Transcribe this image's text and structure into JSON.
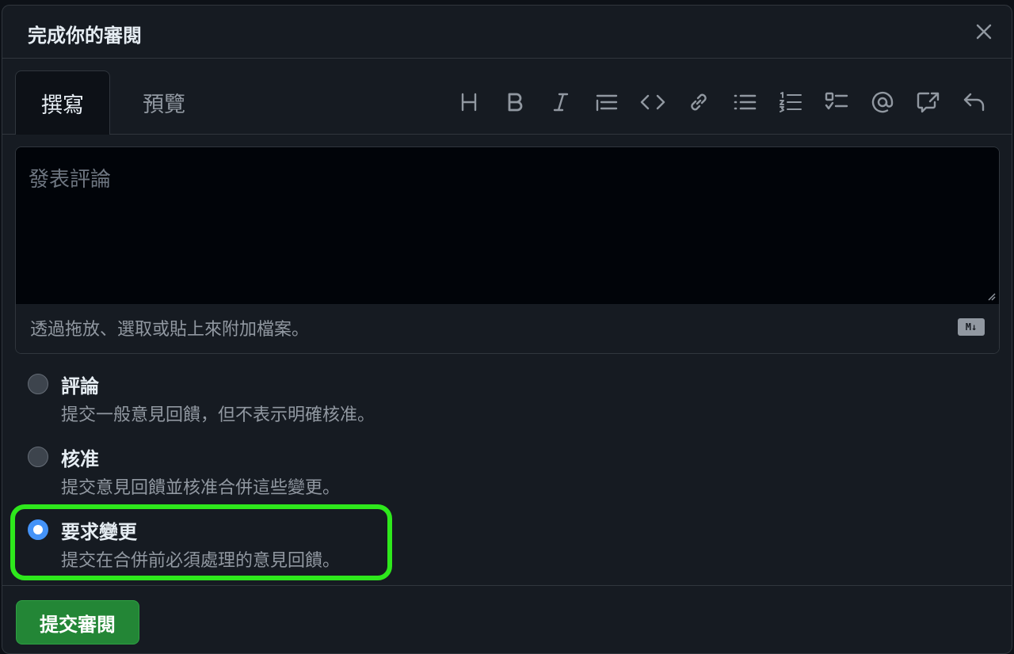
{
  "dialog": {
    "title": "完成你的審閱",
    "close_icon": "close-icon"
  },
  "tabs": [
    {
      "label": "撰寫",
      "active": true
    },
    {
      "label": "預覽",
      "active": false
    }
  ],
  "toolbar": [
    {
      "name": "heading-icon"
    },
    {
      "name": "bold-icon"
    },
    {
      "name": "italic-icon"
    },
    {
      "name": "quote-icon"
    },
    {
      "name": "code-icon"
    },
    {
      "name": "link-icon"
    },
    {
      "name": "unordered-list-icon"
    },
    {
      "name": "ordered-list-icon"
    },
    {
      "name": "task-list-icon"
    },
    {
      "name": "mention-icon"
    },
    {
      "name": "cross-reference-icon"
    },
    {
      "name": "undo-icon"
    }
  ],
  "editor": {
    "placeholder": "發表評論",
    "value": "",
    "file_hint": "透過拖放、選取或貼上來附加檔案。",
    "markdown_badge": "M↓"
  },
  "options": [
    {
      "label": "評論",
      "description": "提交一般意見回饋，但不表示明確核准。",
      "checked": false
    },
    {
      "label": "核准",
      "description": "提交意見回饋並核准合併這些變更。",
      "checked": false
    },
    {
      "label": "要求變更",
      "description": "提交在合併前必須處理的意見回饋。",
      "checked": true
    }
  ],
  "footer": {
    "submit_label": "提交審閱"
  },
  "colors": {
    "background": "#161b22",
    "accent": "#4493f8",
    "submit": "#238636",
    "highlight": "#2ee81c"
  }
}
